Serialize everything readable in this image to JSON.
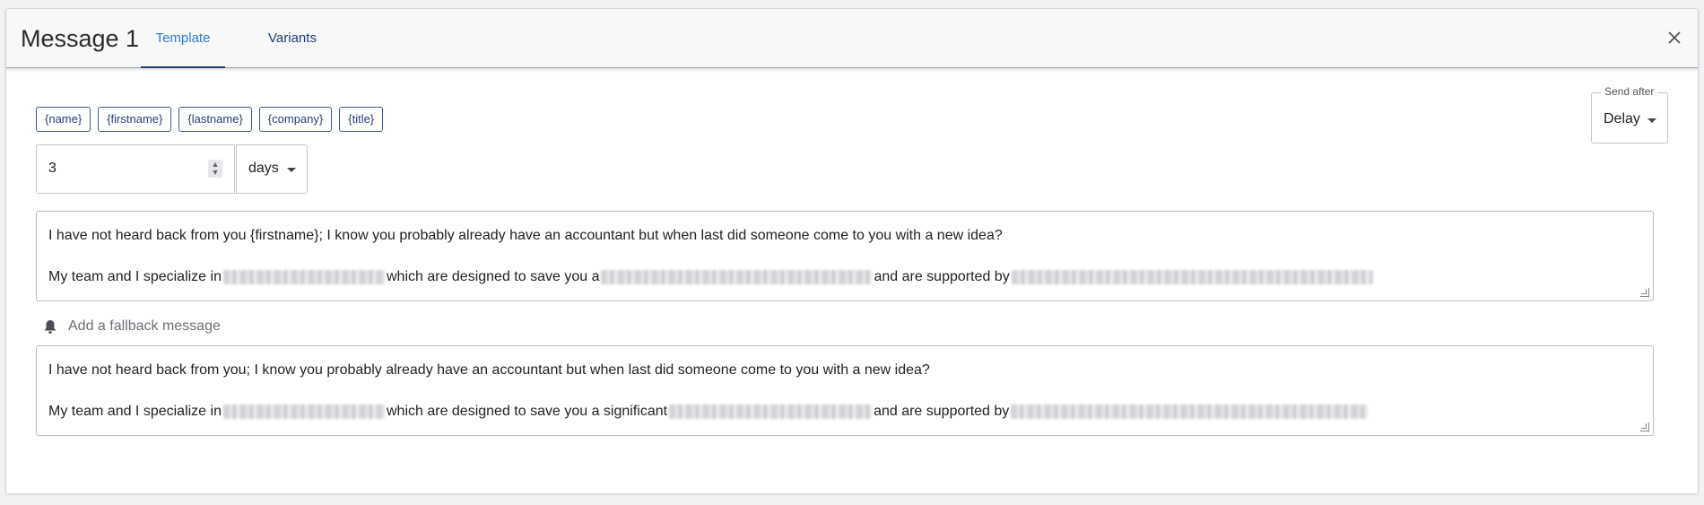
{
  "header": {
    "title": "Message 1",
    "tabs": [
      {
        "label": "Template",
        "active": true
      },
      {
        "label": "Variants",
        "active": false
      }
    ],
    "close_icon": "close-icon"
  },
  "variables": [
    "{name}",
    "{firstname}",
    "{lastname}",
    "{company}",
    "{title}"
  ],
  "delay": {
    "value": "3",
    "unit": "days"
  },
  "send_after": {
    "label": "Send after",
    "value": "Delay"
  },
  "message": {
    "line1": "I have not heard back from you {firstname}; I know you probably already have an accountant but when last did someone come to you with a new idea?",
    "line2_parts": [
      "My team and I specialize in",
      "which are designed to save you a",
      "and are supported by"
    ]
  },
  "fallback": {
    "label": "Add a fallback message",
    "icon": "bell-icon",
    "line1": "I have not heard back from you; I know you probably already have an accountant but when last did someone come to you with a new idea?",
    "line2_parts": [
      "My team and I specialize in",
      "which are designed to save you a significant",
      "and are supported by"
    ]
  },
  "colors": {
    "accent_blue": "#2b7fd0",
    "navy": "#1f3d6e",
    "chip_border": "#3d5a96"
  }
}
